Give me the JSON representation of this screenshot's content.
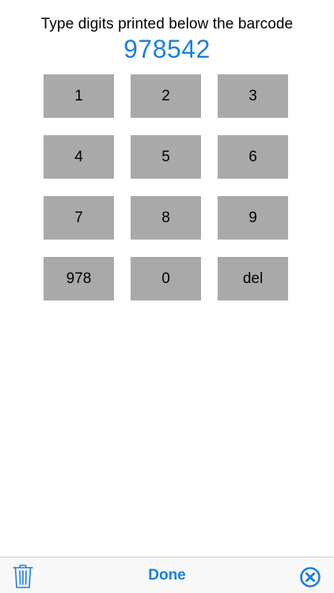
{
  "instruction": "Type digits printed below the barcode",
  "entered_digits": "978542",
  "keys": [
    "1",
    "2",
    "3",
    "4",
    "5",
    "6",
    "7",
    "8",
    "9",
    "978",
    "0",
    "del"
  ],
  "toolbar": {
    "done_label": "Done",
    "left_icon": "trash-icon",
    "right_icon": "close-circle-icon"
  },
  "colors": {
    "accent": "#1a7fe0",
    "key_background": "#a9a9a9",
    "toolbar_background": "#f8f8f8"
  }
}
